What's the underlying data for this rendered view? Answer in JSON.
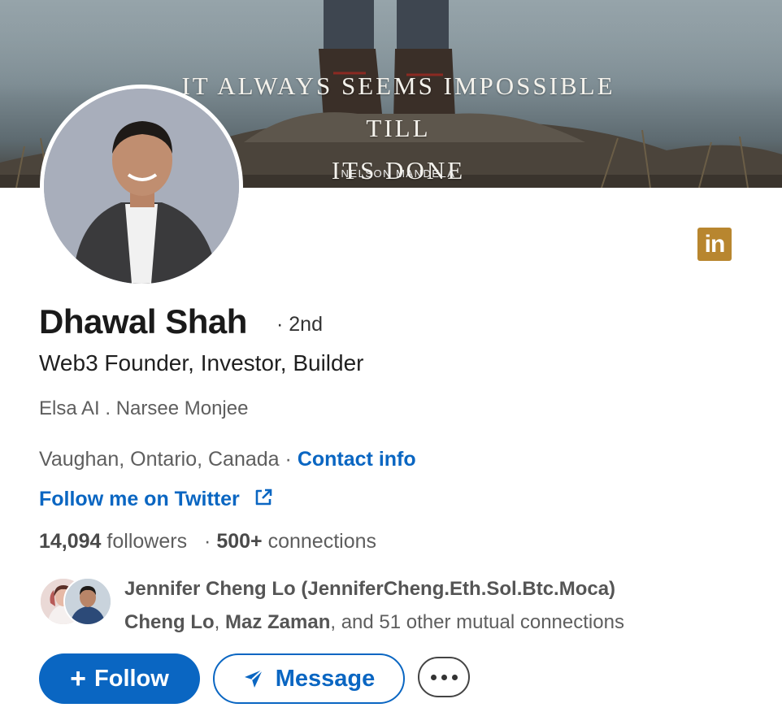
{
  "banner": {
    "quote_line1": "IT ALWAYS SEEMS IMPOSSIBLE TILL",
    "quote_line2": "ITS DONE",
    "author": "NELSON MANDELA"
  },
  "profile": {
    "name": "Dhawal Shah",
    "degree": "· 2nd",
    "headline": "Web3 Founder, Investor, Builder",
    "companies": "Elsa AI . Narsee Monjee",
    "location": "Vaughan, Ontario, Canada ·",
    "contact_info": "Contact info",
    "twitter_link": "Follow me on Twitter",
    "followers_count": "14,094",
    "followers_label": "followers",
    "connections_sep": "·",
    "connections_count": "500+",
    "connections_label": "connections",
    "linkedin_badge": "in"
  },
  "mutual": {
    "line1": "Jennifer Cheng Lo (JenniferCheng.Eth.Sol.Btc.Moca)",
    "name2": "Cheng Lo",
    "sep1": ",",
    "name3": "Maz Zaman",
    "rest": ", and 51 other mutual connections"
  },
  "actions": {
    "follow_label": "Follow",
    "message_label": "Message"
  },
  "colors": {
    "primary": "#0a66c2",
    "badge": "#b8862f"
  }
}
